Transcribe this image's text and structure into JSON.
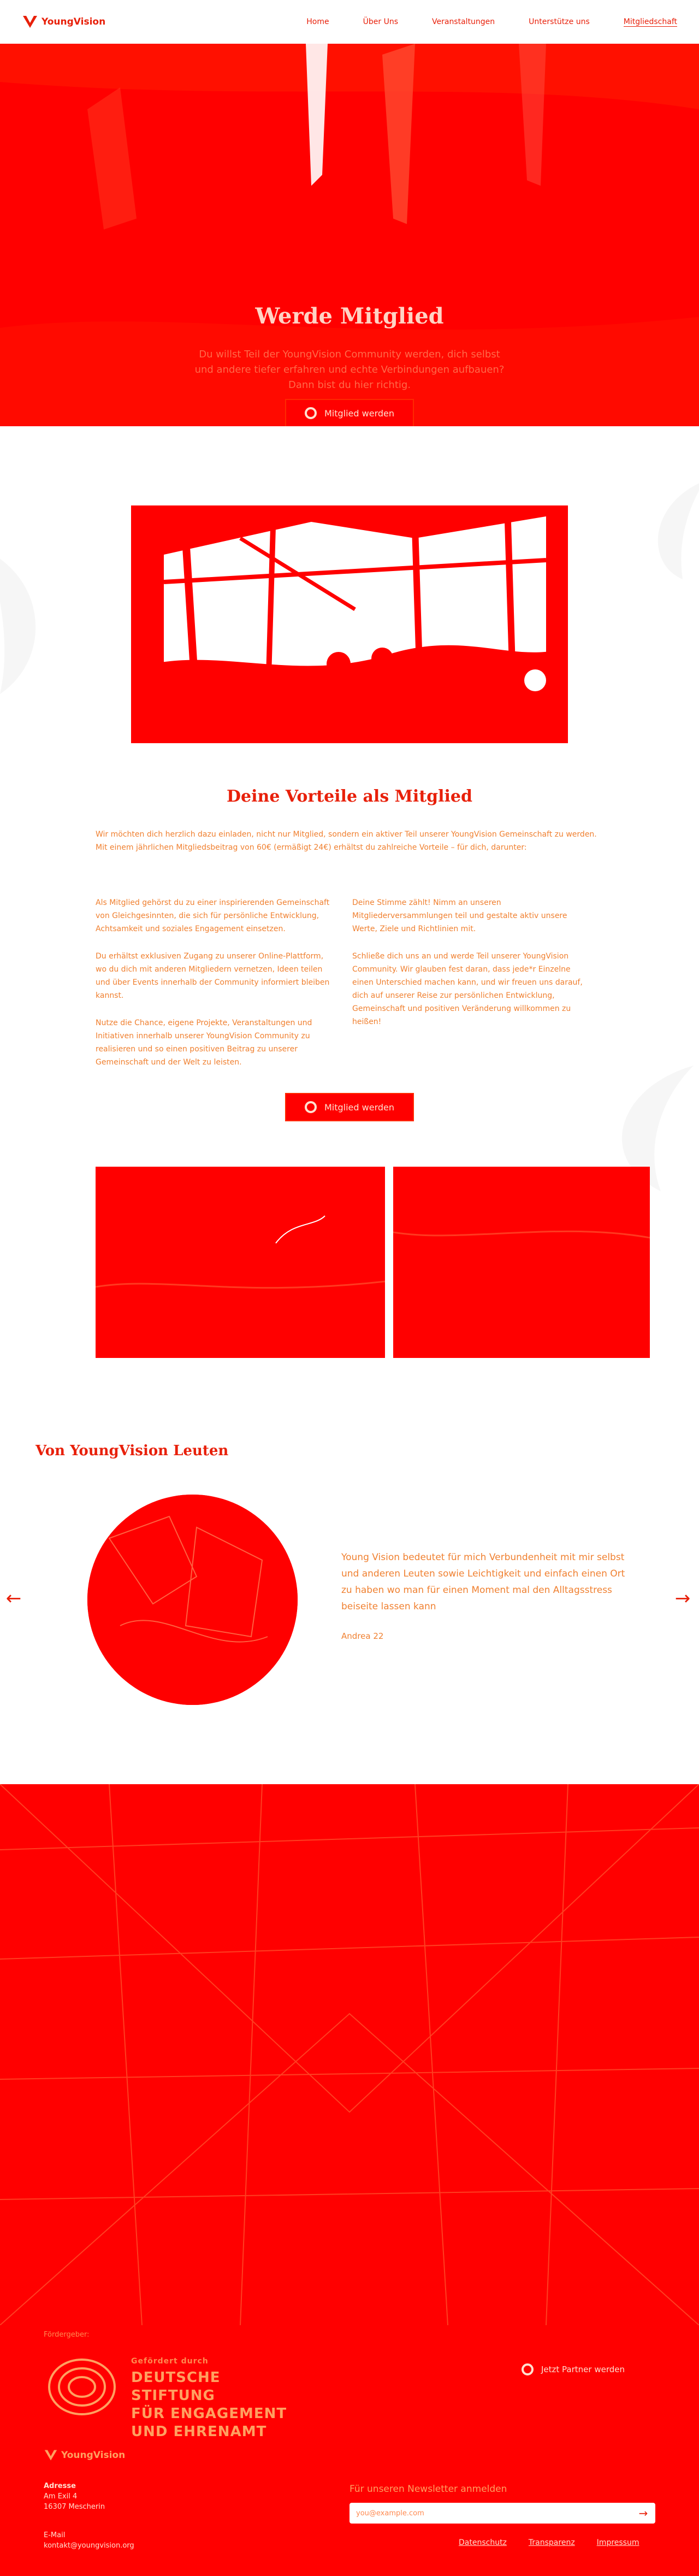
{
  "brand": {
    "name": "YoungVision",
    "colors": {
      "primary": "#e8200a",
      "accent": "#ff0000",
      "text_orange": "#f08030"
    }
  },
  "nav": {
    "logo_text": "YoungVision",
    "items": [
      {
        "label": "Home"
      },
      {
        "label": "Über Uns"
      },
      {
        "label": "Veranstaltungen"
      },
      {
        "label": "Unterstütze uns"
      },
      {
        "label": "Mitgliedschaft",
        "active": true
      }
    ]
  },
  "hero": {
    "title": "Werde Mitglied",
    "subtitle": "Du willst Teil der YoungVision Community werden, dich selbst und andere tiefer erfahren und echte Verbindungen aufbauen? Dann bist du hier richtig.",
    "button_label": "Mitglied werden",
    "button_icon": "ring-icon"
  },
  "benefits": {
    "title": "Deine Vorteile als Mitglied",
    "intro": "Wir möchten dich herzlich dazu einladen, nicht nur Mitglied, sondern ein aktiver Teil unserer YoungVision Gemeinschaft zu werden. Mit einem jährlichen Mitgliedsbeitrag von 60€ (ermäßigt 24€) erhältst du zahlreiche Vorteile – für dich, darunter:",
    "left": [
      "Als Mitglied gehörst du zu einer inspirierenden Gemeinschaft von Gleichgesinnten, die sich für persönliche Entwicklung, Achtsamkeit und soziales Engagement einsetzen.",
      "Du erhältst exklusiven Zugang zu unserer Online-Plattform, wo du dich mit anderen Mitgliedern vernetzen, Ideen teilen und über Events innerhalb der Community informiert bleiben kannst.",
      "Nutze die Chance, eigene Projekte, Veranstaltungen und Initiativen innerhalb unserer YoungVision Community zu realisieren und so einen positiven Beitrag zu unserer Gemeinschaft und der Welt zu leisten."
    ],
    "right": [
      "Deine Stimme zählt! Nimm an unseren Mitgliederversammlungen teil und gestalte aktiv unsere Werte, Ziele und Richtlinien mit.",
      "Schließe dich uns an und werde Teil unserer YoungVision Community. Wir glauben fest daran, dass jede*r Einzelne einen Unterschied machen kann, und wir freuen uns darauf, dich auf unserer Reise zur persönlichen Entwicklung, Gemeinschaft und positiven Veränderung willkommen zu heißen!"
    ],
    "button_label": "Mitglied werden",
    "button_icon": "ring-icon"
  },
  "testimonials": {
    "title": "Von YoungVision Leuten",
    "quote": "Young Vision bedeutet für mich Verbundenheit mit mir selbst und anderen Leuten sowie Leichtigkeit und einfach einen Ort zu haben wo man für einen Moment mal den Alltagsstress beiseite lassen kann",
    "author": "Andrea 22",
    "prev_icon": "arrow-left-icon",
    "next_icon": "arrow-right-icon"
  },
  "footer": {
    "funder_label": "Fördergeber:",
    "funder_small": "Gefördert durch",
    "funder_lines": [
      "DEUTSCHE STIFTUNG",
      "FÜR ENGAGEMENT",
      "UND EHRENAMT"
    ],
    "partner_label": "Jetzt Partner werden",
    "logo_text": "YoungVision",
    "address_label": "Adresse",
    "address_lines": [
      "Am Exil 4",
      "16307 Mescherin"
    ],
    "email_label": "E-Mail",
    "email": "kontakt@youngvision.org",
    "newsletter_label": "Für unseren Newsletter anmelden",
    "newsletter_placeholder": "you@example.com",
    "links": [
      "Datenschutz",
      "Transparenz",
      "Impressum"
    ]
  }
}
